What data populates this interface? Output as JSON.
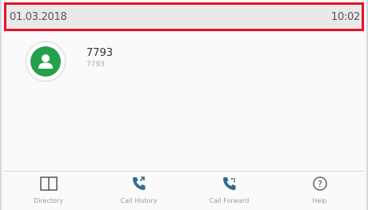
{
  "status_bar": {
    "date": "01.03.2018",
    "time": "10:02"
  },
  "contact": {
    "name": "7793",
    "number": "7793",
    "avatar_color": "#23a14a"
  },
  "softkeys": [
    {
      "label": "Directory",
      "icon": "directory-icon"
    },
    {
      "label": "Call History",
      "icon": "call-history-icon"
    },
    {
      "label": "Call Forward",
      "icon": "call-forward-icon"
    },
    {
      "label": "Help",
      "icon": "help-icon"
    }
  ],
  "colors": {
    "highlight_border": "#e4122a",
    "accent": "#23a14a"
  }
}
